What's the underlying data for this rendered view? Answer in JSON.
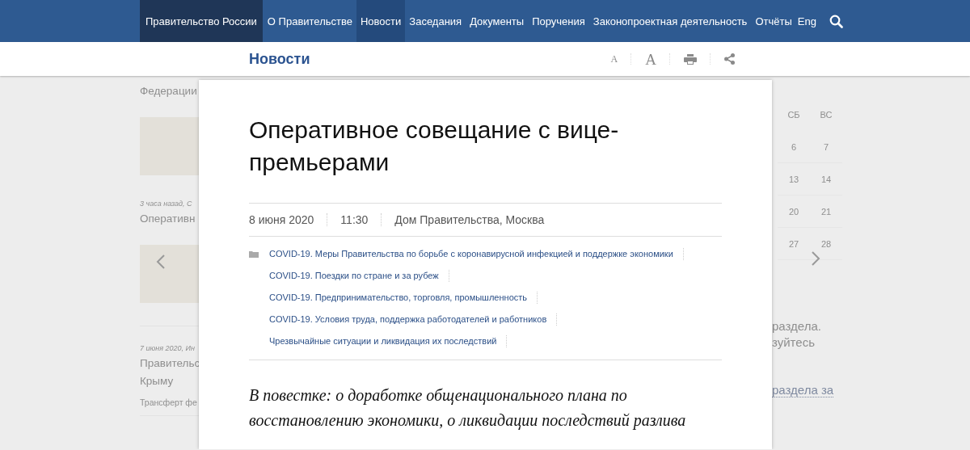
{
  "nav": {
    "items": [
      {
        "label": "Правительство России",
        "kind": "brand",
        "selected": false
      },
      {
        "label": "О Правительстве",
        "kind": "link",
        "selected": false
      },
      {
        "label": "Новости",
        "kind": "link",
        "selected": true
      },
      {
        "label": "Заседания",
        "kind": "link",
        "selected": false
      },
      {
        "label": "Документы",
        "kind": "link",
        "selected": false
      },
      {
        "label": "Поручения",
        "kind": "link",
        "selected": false
      },
      {
        "label": "Законопроектная деятельность",
        "kind": "link",
        "selected": false
      },
      {
        "label": "Отчёты",
        "kind": "link",
        "selected": false
      },
      {
        "label": "Eng",
        "kind": "lang",
        "selected": false
      }
    ]
  },
  "subheader": {
    "title": "Новости",
    "font_small": "A",
    "font_large": "A"
  },
  "background": {
    "left": [
      {
        "kind": "title",
        "text": "Федерации"
      },
      {
        "kind": "photo"
      },
      {
        "kind": "meta",
        "text": "3 часа назад, С"
      },
      {
        "kind": "title",
        "text": "Оперативн"
      },
      {
        "kind": "photo"
      },
      {
        "kind": "divider"
      },
      {
        "kind": "meta",
        "text": "7 июня 2020, Ин"
      },
      {
        "kind": "title",
        "text": "Правительс"
      },
      {
        "kind": "title",
        "text": "Крыму"
      },
      {
        "kind": "lead",
        "text": "Трансферт фе"
      },
      {
        "kind": "divider"
      }
    ],
    "calendar": {
      "weekdays": [
        "СБ",
        "ВС"
      ],
      "weeks": [
        [
          "6",
          "7"
        ],
        [
          "13",
          "14"
        ],
        [
          "20",
          "21"
        ],
        [
          "27",
          "28"
        ]
      ]
    },
    "right": [
      {
        "kind": "text",
        "text": "раздела."
      },
      {
        "kind": "text",
        "text": "зуйтесь"
      },
      {
        "kind": "link",
        "text": "раздела за"
      }
    ]
  },
  "article": {
    "title": "Оперативное совещание с вице-премьерами",
    "date": "8 июня 2020",
    "time": "11:30",
    "place": "Дом Правительства, Москва",
    "tags": [
      "COVID-19. Меры Правительства по борьбе с коронавирусной инфекцией и поддержке экономики",
      "COVID-19. Поездки по стране и за рубеж",
      "COVID-19. Предпринимательство, торговля, промышленность",
      "COVID-19. Условия труда, поддержка работодателей и работников",
      "Чрезвычайные ситуации и ликвидация их последствий"
    ],
    "lead": "В повестке: о доработке общенационального плана по восстановлению экономики, о ликвидации последствий разлива"
  }
}
